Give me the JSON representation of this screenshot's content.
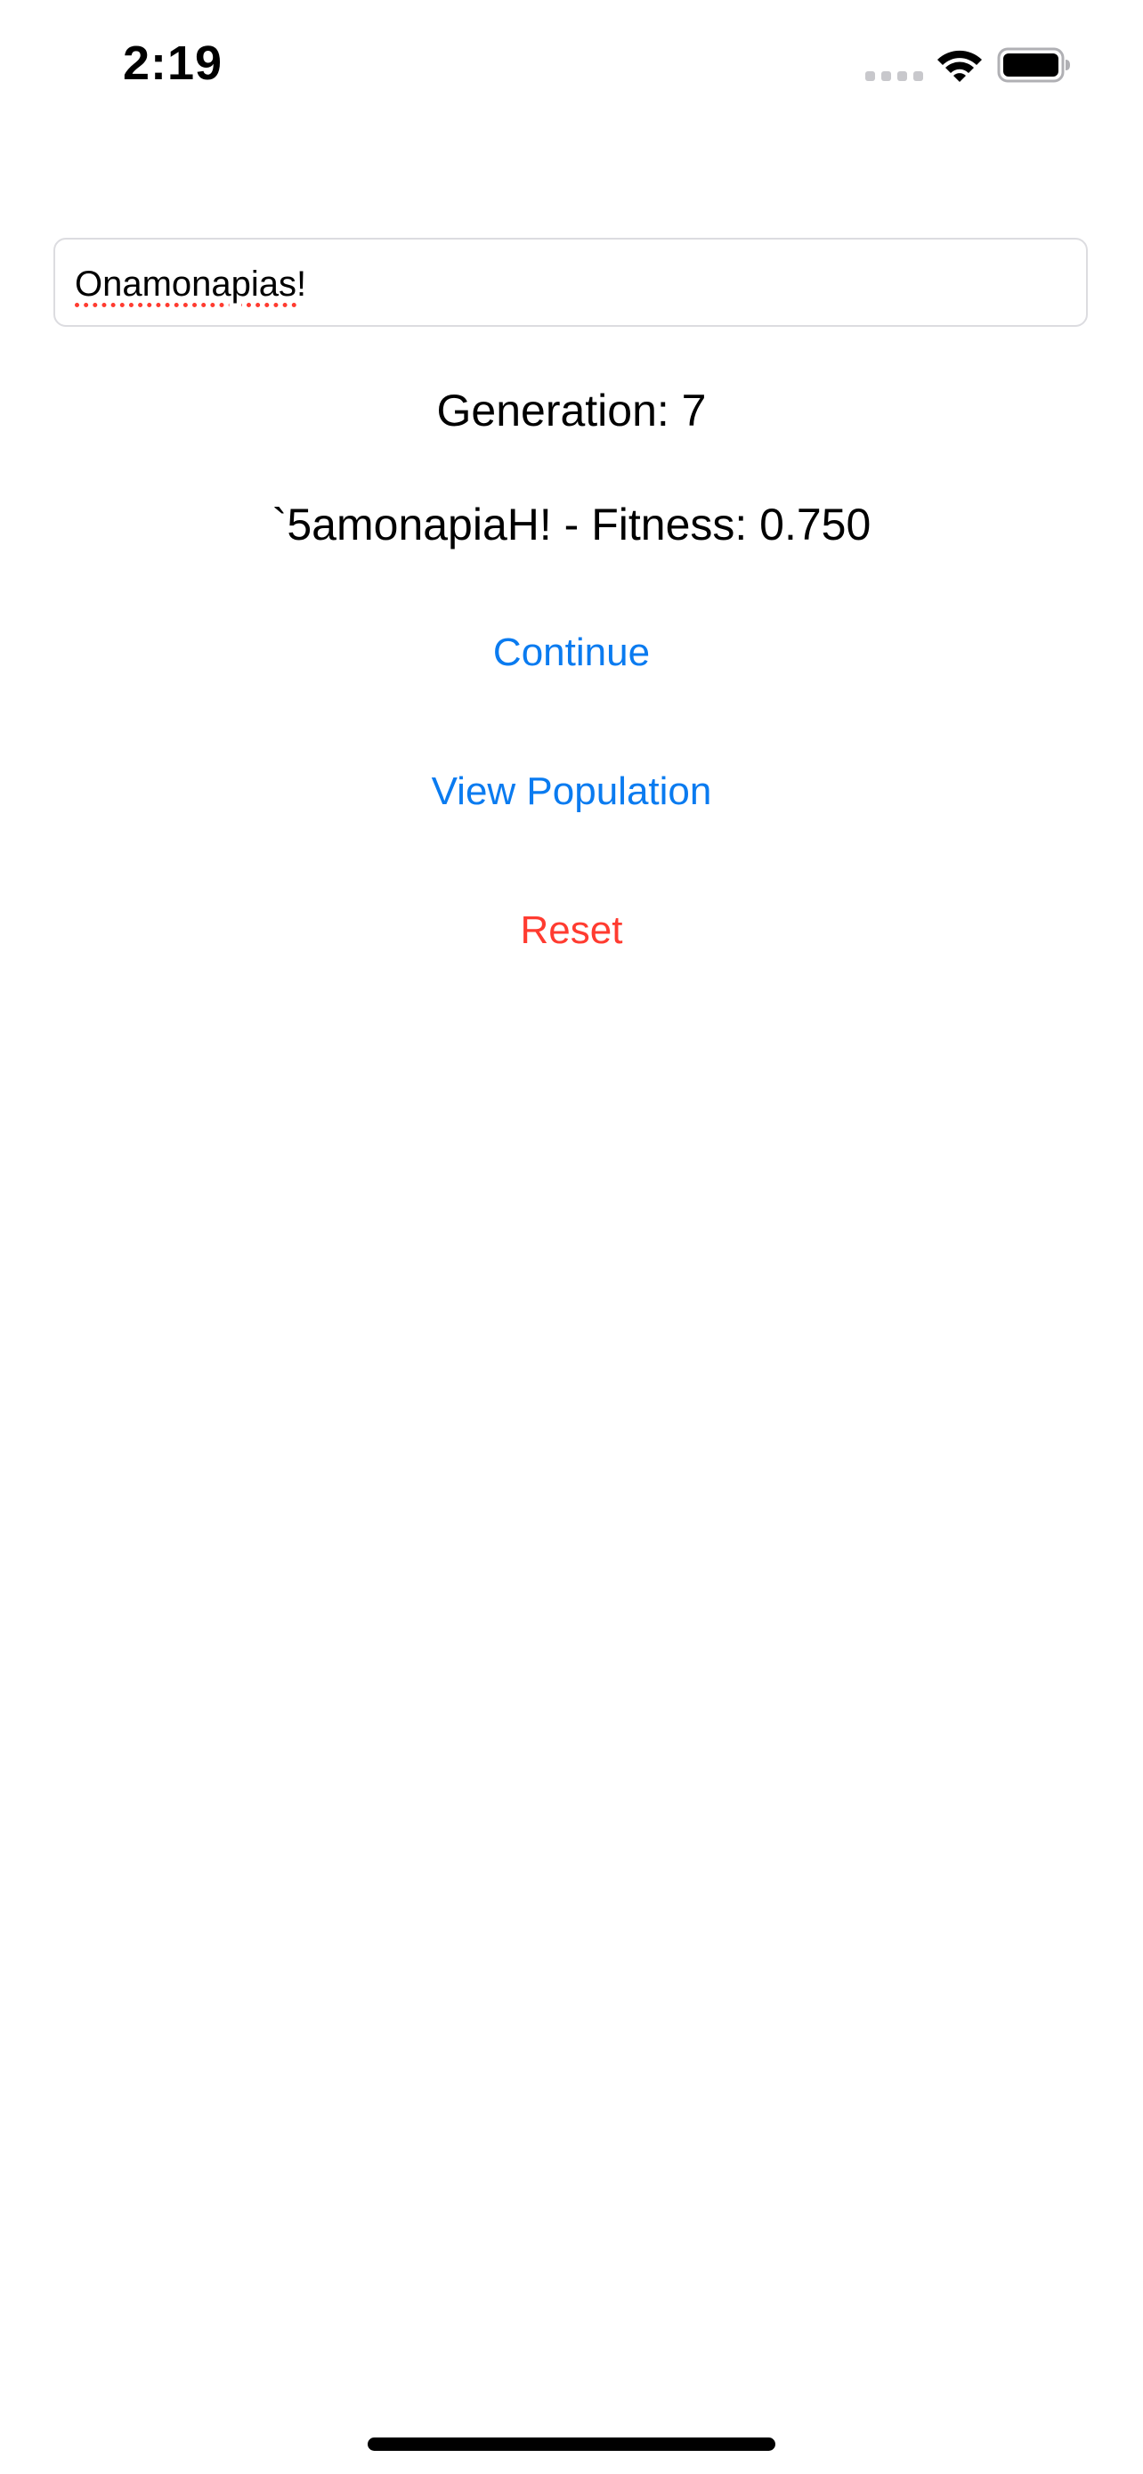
{
  "status_bar": {
    "time": "2:19",
    "icons": [
      "cellular-signal-icon",
      "wifi-icon",
      "battery-icon"
    ]
  },
  "target_field": {
    "value": "Onamonapias!",
    "spellcheck_flagged_word": "Onamonapias",
    "trailing_text": "!"
  },
  "generation_label": "Generation: 7",
  "best_candidate_label": "`5amonapiaH! - Fitness: 0.750",
  "buttons": {
    "continue": "Continue",
    "view_population": "View Population",
    "reset": "Reset"
  },
  "colors": {
    "accent": "#0a7bf0",
    "destructive": "#ff3b30",
    "text": "#000000",
    "background": "#ffffff"
  }
}
